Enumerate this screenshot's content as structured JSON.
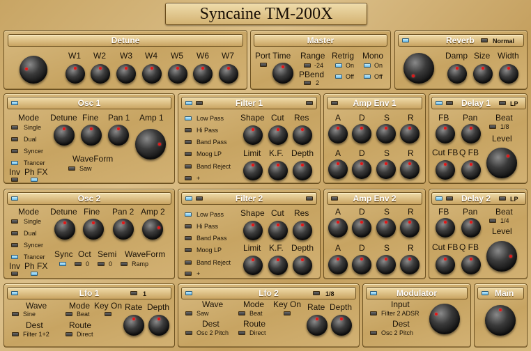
{
  "app": {
    "title": "Syncaine TM-200X"
  },
  "detune": {
    "title": "Detune",
    "labels": [
      "W1",
      "W2",
      "W3",
      "W4",
      "W5",
      "W6",
      "W7"
    ]
  },
  "master": {
    "title": "Master",
    "port_time": "Port Time",
    "range": "Range",
    "range_val": "-24",
    "retrig": "Retrig",
    "on": "On",
    "off": "Off",
    "mono": "Mono",
    "pbend": "PBend",
    "pbend_val": "2"
  },
  "reverb": {
    "title": "Reverb",
    "mode": "Normal",
    "damp": "Damp",
    "size": "Size",
    "width": "Width"
  },
  "osc1": {
    "title": "Osc 1",
    "mode": "Mode",
    "modes": [
      "Single",
      "Dual",
      "Syncer",
      "Trancer"
    ],
    "detune": "Detune",
    "fine": "Fine",
    "pan": "Pan 1",
    "amp": "Amp 1",
    "waveform": "WaveForm",
    "wave_val": "Saw",
    "inv": "Inv",
    "phfx": "Ph FX"
  },
  "osc2": {
    "title": "Osc 2",
    "mode": "Mode",
    "modes": [
      "Single",
      "Dual",
      "Syncer",
      "Trancer"
    ],
    "detune": "Detune",
    "fine": "Fine",
    "pan": "Pan 2",
    "amp": "Amp 2",
    "sync": "Sync",
    "oct": "Oct",
    "oct_val": "0",
    "semi": "Semi",
    "semi_val": "0",
    "waveform": "WaveForm",
    "wave_val": "Ramp",
    "inv": "Inv",
    "phfx": "Ph FX"
  },
  "filter1": {
    "title": "Filter 1",
    "types": [
      "Low Pass",
      "Hi Pass",
      "Band Pass",
      "Moog LP",
      "Band Reject",
      "+"
    ],
    "shape": "Shape",
    "cut": "Cut",
    "res": "Res",
    "limit": "Limit",
    "kf": "K.F.",
    "depth": "Depth"
  },
  "filter2": {
    "title": "Filter 2",
    "types": [
      "Low Pass",
      "Hi Pass",
      "Band Pass",
      "Moog LP",
      "Band Reject",
      "+"
    ],
    "shape": "Shape",
    "cut": "Cut",
    "res": "Res",
    "limit": "Limit",
    "kf": "K.F.",
    "depth": "Depth"
  },
  "ampenv1": {
    "title": "Amp Env 1",
    "row1": [
      "A",
      "D",
      "S",
      "R"
    ],
    "row2": [
      "A",
      "D",
      "S",
      "R"
    ]
  },
  "ampenv2": {
    "title": "Amp Env 2",
    "row1": [
      "A",
      "D",
      "S",
      "R"
    ],
    "row2": [
      "A",
      "D",
      "S",
      "R"
    ]
  },
  "delay1": {
    "title": "Delay 1",
    "mode": "LP",
    "fb": "FB",
    "pan": "Pan",
    "beat": "Beat",
    "beat_val": "1/8",
    "level": "Level",
    "cutfb": "Cut FB",
    "qfb": "Q FB"
  },
  "delay2": {
    "title": "Delay 2",
    "mode": "LP",
    "fb": "FB",
    "pan": "Pan",
    "beat": "Beat",
    "beat_val": "1/4",
    "level": "Level",
    "cutfb": "Cut FB",
    "qfb": "Q FB"
  },
  "lfo1": {
    "title": "Lfo 1",
    "rate_val": "1",
    "wave": "Wave",
    "wave_val": "Sine",
    "mode": "Mode",
    "mode_val": "Beat",
    "keyon": "Key On",
    "dest": "Dest",
    "dest_val": "Filter 1+2",
    "route": "Route",
    "route_val": "Direct",
    "rate": "Rate",
    "depth": "Depth"
  },
  "lfo2": {
    "title": "Lfo 2",
    "rate_val": "1/8",
    "wave": "Wave",
    "wave_val": "Saw",
    "mode": "Mode",
    "mode_val": "Beat",
    "keyon": "Key On",
    "dest": "Dest",
    "dest_val": "Osc 2 Pitch",
    "route": "Route",
    "route_val": "Direct",
    "rate": "Rate",
    "depth": "Depth"
  },
  "modulator": {
    "title": "Modulator",
    "input": "Input",
    "input_val": "Filter 2 ADSR",
    "dest": "Dest",
    "dest_val": "Osc 2 Pitch"
  },
  "main": {
    "title": "Main"
  },
  "colors": {
    "led_on": "#66b8e8",
    "knob_marker": "#e01818",
    "panel": "#c9a462"
  }
}
